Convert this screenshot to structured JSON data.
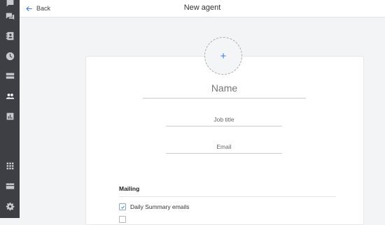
{
  "sidebar": {
    "items": [
      {
        "icon": "chat-icon"
      },
      {
        "icon": "contacts-book-icon"
      },
      {
        "icon": "clock-icon"
      },
      {
        "icon": "inbox-icon"
      },
      {
        "icon": "people-icon",
        "active": true
      },
      {
        "icon": "chart-icon"
      },
      {
        "icon": "apps-grid-icon"
      },
      {
        "icon": "card-icon"
      },
      {
        "icon": "gear-icon"
      }
    ]
  },
  "header": {
    "back_label": "Back",
    "title": "New agent"
  },
  "form": {
    "avatar_add_symbol": "+",
    "name_placeholder": "Name",
    "job_placeholder": "Job title",
    "email_placeholder": "Email"
  },
  "mailing": {
    "heading": "Mailing",
    "options": [
      {
        "label": "Daily Summary emails",
        "checked": true
      }
    ]
  },
  "colors": {
    "sidebar_bg": "#3e3f44",
    "accent": "#3b7ddd"
  }
}
